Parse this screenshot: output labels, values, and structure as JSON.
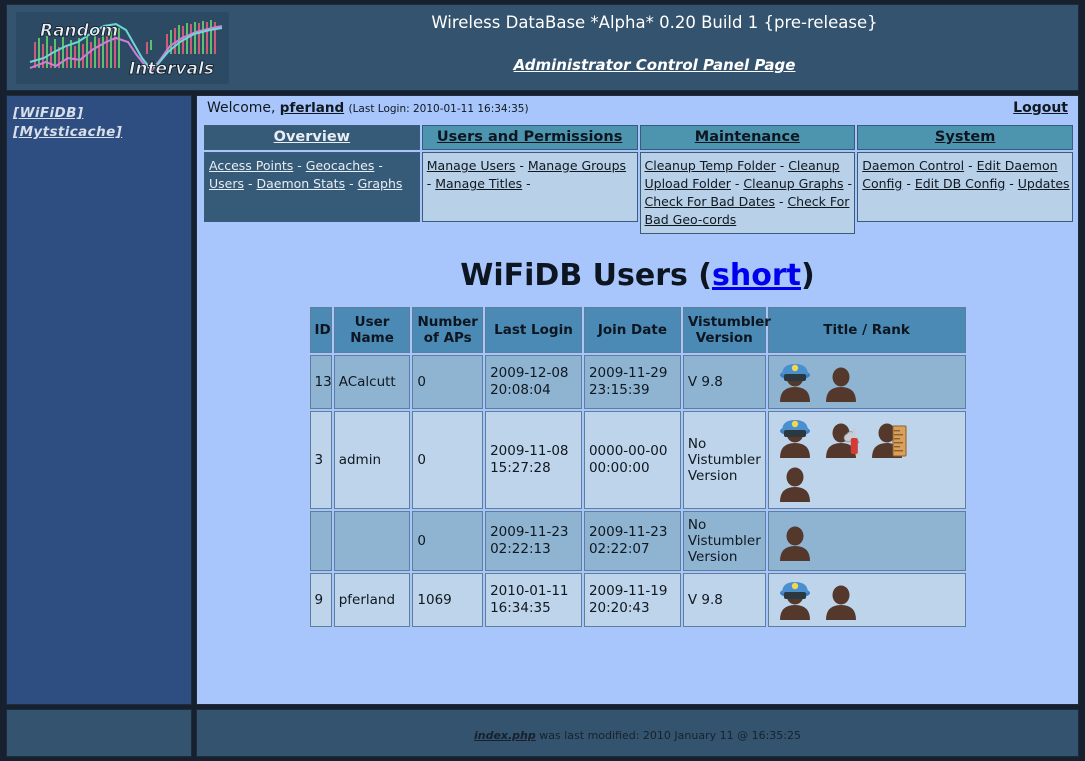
{
  "header": {
    "title": "Wireless DataBase *Alpha* 0.20 Build 1 {pre-release}",
    "subtitle": "Administrator Control Panel Page",
    "logo_line1": "Random",
    "logo_line2": "Intervals"
  },
  "sidebar": {
    "links": [
      {
        "label": "[WiFiDB]"
      },
      {
        "label": "[Mytsticache]"
      }
    ]
  },
  "welcome": {
    "greeting": "Welcome,",
    "user": "pferland",
    "meta": "(Last Login: 2010-01-11 16:34:35)",
    "logout": "Logout"
  },
  "nav": {
    "columns": [
      {
        "heading": "Overview",
        "active": true,
        "links": [
          "Access Points",
          "Geocaches",
          "Users",
          "Daemon Stats",
          "Graphs"
        ]
      },
      {
        "heading": "Users and Permissions",
        "active": false,
        "links": [
          "Manage Users",
          "Manage Groups",
          "Manage Titles"
        ]
      },
      {
        "heading": "Maintenance",
        "active": false,
        "links": [
          "Cleanup Temp Folder",
          "Cleanup Upload Folder",
          "Cleanup Graphs",
          "Check For Bad Dates",
          "Check For Bad Geo-cords"
        ]
      },
      {
        "heading": "System",
        "active": false,
        "links": [
          "Daemon Control",
          "Edit Daemon Config",
          "Edit DB Config",
          "Updates"
        ]
      }
    ]
  },
  "page": {
    "title_main": "WiFiDB Users (",
    "title_link": "short",
    "title_tail": ")"
  },
  "table": {
    "headers": [
      "ID",
      "User Name",
      "Number of APs",
      "Last Login",
      "Join Date",
      "Vistumbler Version",
      "Title / Rank"
    ],
    "header_lines": [
      [
        "ID"
      ],
      [
        "User",
        "Name"
      ],
      [
        "Number",
        "of APs"
      ],
      [
        "Last Login"
      ],
      [
        "Join Date"
      ],
      [
        "Vistumbler",
        "Version"
      ],
      [
        "Title / Rank"
      ]
    ],
    "rows": [
      {
        "id": "13",
        "username": "ACalcutt",
        "aps": "0",
        "last_login_date": "2009-12-08",
        "last_login_time": "20:08:04",
        "join_date": "2009-11-29",
        "join_time": "23:15:39",
        "vistumbler": "V 9.8",
        "ranks": [
          "police-officer-icon",
          "user-silhouette-icon"
        ]
      },
      {
        "id": "3",
        "username": "admin",
        "aps": "0",
        "last_login_date": "2009-11-08",
        "last_login_time": "15:27:28",
        "join_date": "0000-00-00",
        "join_time": "00:00:00",
        "vistumbler": "No Vistumbler Version",
        "ranks": [
          "police-officer-icon",
          "technician-icon",
          "builder-icon",
          "user-silhouette-icon"
        ]
      },
      {
        "id": "",
        "username": "",
        "aps": "0",
        "last_login_date": "2009-11-23",
        "last_login_time": "02:22:13",
        "join_date": "2009-11-23",
        "join_time": "02:22:07",
        "vistumbler": "No Vistumbler Version",
        "ranks": [
          "user-silhouette-icon"
        ]
      },
      {
        "id": "9",
        "username": "pferland",
        "aps": "1069",
        "last_login_date": "2010-01-11",
        "last_login_time": "16:34:35",
        "join_date": "2009-11-19",
        "join_time": "20:20:43",
        "vistumbler": "V 9.8",
        "ranks": [
          "police-officer-icon",
          "user-silhouette-icon"
        ]
      }
    ]
  },
  "footer": {
    "file": "index.php",
    "text": " was last modified: 2010 January 11 @ 16:35:25"
  },
  "colors": {
    "page_bg": "#16202e",
    "header_bg": "#34536e",
    "sidebar_bg": "#2e4e82",
    "main_bg": "#a8c6fb",
    "tab_teal": "#4d95ae",
    "tab_active": "#355b78",
    "panel_light": "#b8d0e8",
    "row_odd": "#8eb4d2",
    "row_even": "#bdd4ea",
    "th_bg": "#4b8ab4"
  }
}
